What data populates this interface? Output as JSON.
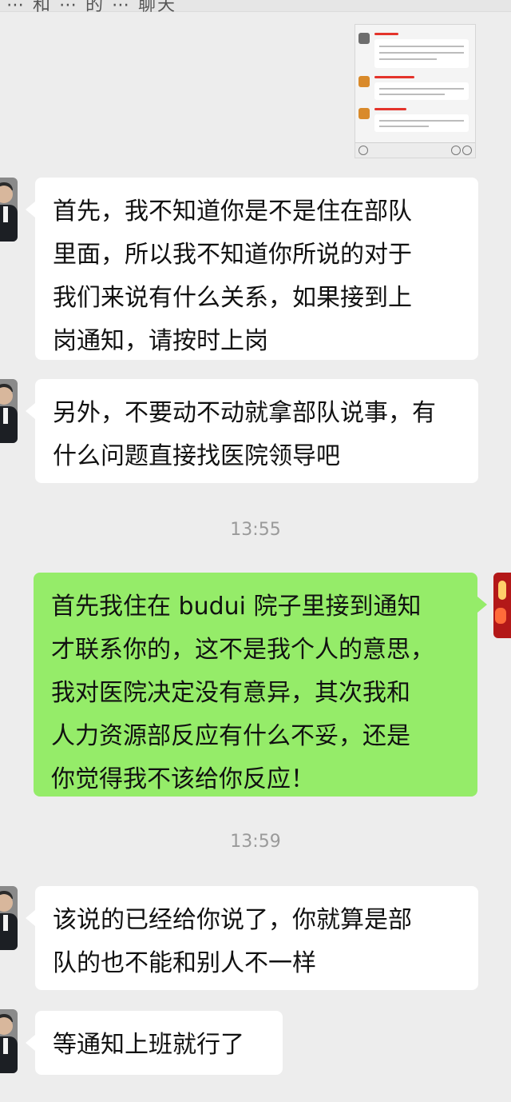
{
  "header": {
    "title_partial": "⋯ 和 ⋯ 的 ⋯ 聊天"
  },
  "embedded_screenshot": {
    "label": "image-attachment"
  },
  "messages": [
    {
      "sender": "other",
      "text": "首先，我不知道你是不是住在部队\n里面，所以我不知道你所说的对于\n我们来说有什么关系，如果接到上\n岗通知，请按时上岗"
    },
    {
      "sender": "other",
      "text": "另外，不要动不动就拿部队说事，有\n什么问题直接找医院领导吧"
    },
    {
      "sender": "self",
      "time": "13:55",
      "text": "首先我住在 budui 院子里接到通知\n才联系你的，这不是我个人的意思，\n我对医院决定没有意异，其次我和\n人力资源部反应有什么不妥，还是\n你觉得我不该给你反应！"
    },
    {
      "sender": "other",
      "time": "13:59",
      "text": "该说的已经给你说了，你就算是部\n队的也不能和别人不一样"
    },
    {
      "sender": "other",
      "text": "等通知上班就行了"
    }
  ],
  "timestamps": {
    "t1": "13:55",
    "t2": "13:59"
  },
  "colors": {
    "background": "#ededed",
    "self_bubble": "#95ec69",
    "other_bubble": "#ffffff",
    "timestamp": "#9a9a9a"
  },
  "icons": [
    "user-avatar-icon",
    "own-avatar-icon",
    "voice-icon",
    "emoji-icon",
    "add-icon"
  ]
}
